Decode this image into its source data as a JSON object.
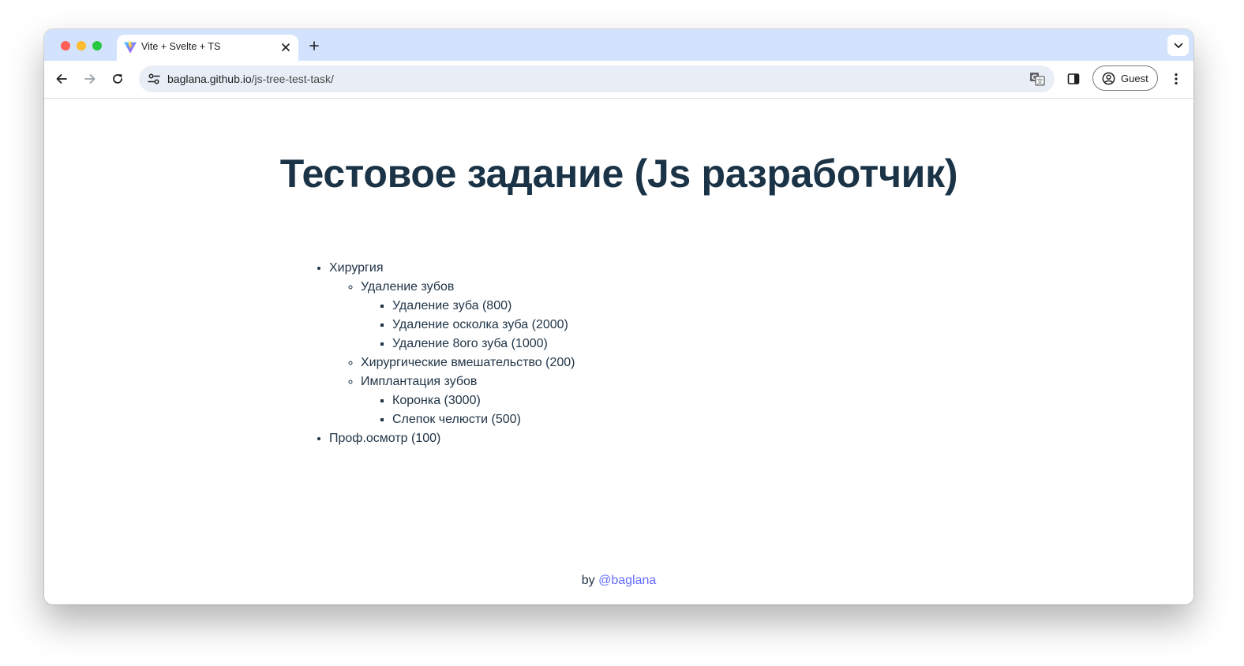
{
  "browser": {
    "tab": {
      "title": "Vite + Svelte + TS",
      "favicon": "vite-logo-icon",
      "close_icon": "close-icon"
    },
    "new_tab_icon": "plus-icon",
    "tab_search_icon": "chevron-down-icon",
    "toolbar": {
      "back_icon": "back-arrow-icon",
      "forward_icon": "forward-arrow-icon",
      "reload_icon": "reload-icon",
      "site_info_icon": "tune-icon",
      "url_host": "baglana.github.io",
      "url_path": "/js-tree-test-task/",
      "translate_icon": "translate-icon",
      "side_panel_icon": "side-panel-icon",
      "profile_label": "Guest",
      "profile_icon": "account-circle-icon",
      "menu_icon": "kebab-menu-icon"
    },
    "colors": {
      "tabstrip": "#d3e3fd",
      "omnibox": "#e9eef6",
      "close": "#ff5f57",
      "minimize": "#febc2e",
      "maximize": "#28c840"
    }
  },
  "page": {
    "title": "Тестовое задание (Js разработчик)",
    "tree": [
      {
        "label": "Хирургия",
        "children": [
          {
            "label": "Удаление зубов",
            "children": [
              {
                "label": "Удаление зуба (800)"
              },
              {
                "label": "Удаление осколка зуба (2000)"
              },
              {
                "label": "Удаление 8ого зуба (1000)"
              }
            ]
          },
          {
            "label": "Хирургические вмешательство (200)"
          },
          {
            "label": "Имплантация зубов",
            "children": [
              {
                "label": "Коронка (3000)"
              },
              {
                "label": "Слепок челюсти (500)"
              }
            ]
          }
        ]
      },
      {
        "label": "Проф.осмотр (100)"
      }
    ],
    "footer": {
      "prefix": "by",
      "link_text": "@baglana"
    },
    "colors": {
      "title": "#1b3346",
      "text": "#213547",
      "link": "#646cff"
    }
  }
}
